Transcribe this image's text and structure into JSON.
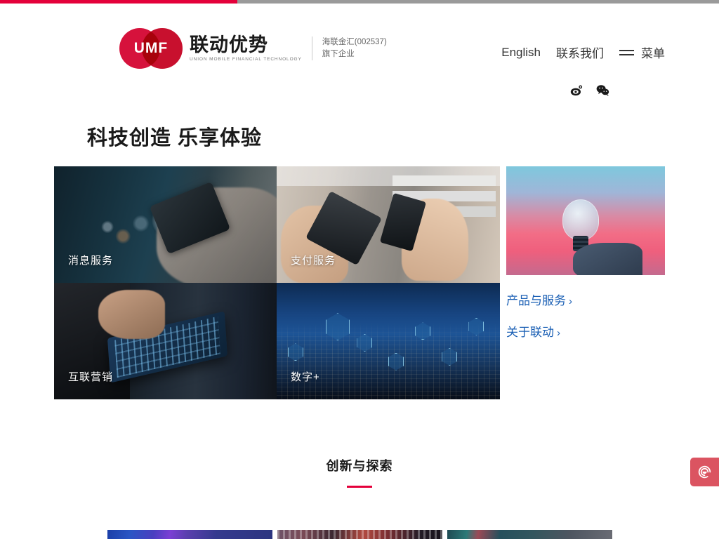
{
  "progress": {
    "percent": 33,
    "fill_color": "#E4003A",
    "track_color": "#9a9a9a"
  },
  "brand": {
    "mark_text": "UMF",
    "name_cn": "联动优势",
    "name_en": "UNION MOBILE FINANCIAL TECHNOLOGY",
    "parent_line1": "海联金汇(002537)",
    "parent_line2": "旗下企业",
    "color": "#D6123C"
  },
  "nav": {
    "english_label": "English",
    "contact_label": "联系我们",
    "menu_label": "菜单",
    "hamburger_icon": "hamburger-icon"
  },
  "socials": [
    {
      "name": "weibo-icon",
      "label": "微博"
    },
    {
      "name": "wechat-icon",
      "label": "微信"
    }
  ],
  "hero": {
    "title": "科技创造 乐享体验"
  },
  "mosaic": {
    "tiles": [
      {
        "id": "message",
        "label": "消息服务"
      },
      {
        "id": "payment",
        "label": "支付服务"
      },
      {
        "id": "marketing",
        "label": "互联营销"
      },
      {
        "id": "digital",
        "label": "数字+"
      },
      {
        "id": "lightbulb",
        "label": ""
      }
    ]
  },
  "side_links": [
    {
      "label": "产品与服务",
      "chevron": "›",
      "color": "#1a5fb4"
    },
    {
      "label": "关于联动",
      "chevron": "›",
      "color": "#1a5fb4"
    }
  ],
  "section": {
    "title": "创新与探索",
    "rule_color": "#E4003A"
  },
  "cards": [
    {
      "id": "card-1"
    },
    {
      "id": "card-2"
    },
    {
      "id": "card-3"
    }
  ],
  "service_button": {
    "icon": "headset-icon",
    "color": "#DB5461"
  }
}
